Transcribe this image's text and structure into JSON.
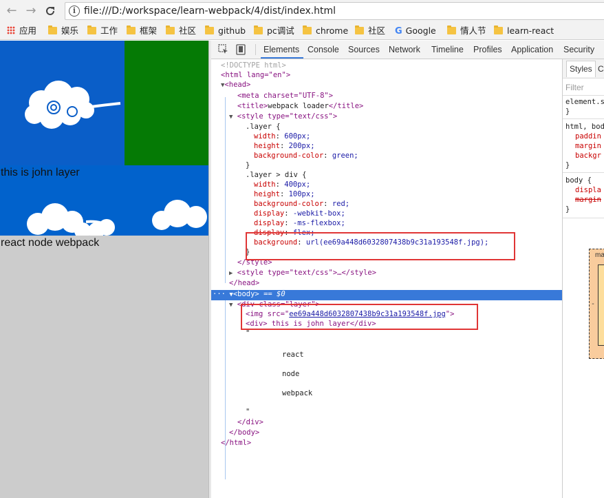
{
  "browser": {
    "url": "file:///D:/workspace/learn-webpack/4/dist/index.html",
    "info_icon_glyph": "i",
    "back_glyph": "←",
    "forward_glyph": "→",
    "reload_glyph": "C"
  },
  "bookmarks": [
    {
      "label": "应用",
      "icon": "apps-icon"
    },
    {
      "label": "娱乐",
      "icon": "folder-icon"
    },
    {
      "label": "工作",
      "icon": "folder-icon"
    },
    {
      "label": "框架",
      "icon": "folder-icon"
    },
    {
      "label": "社区",
      "icon": "folder-icon"
    },
    {
      "label": "github",
      "icon": "folder-icon"
    },
    {
      "label": "pc调试",
      "icon": "folder-icon"
    },
    {
      "label": "chrome",
      "icon": "folder-icon"
    },
    {
      "label": "社区",
      "icon": "folder-icon"
    },
    {
      "label": "Google",
      "icon": "google-icon",
      "glyph": "G"
    },
    {
      "label": "情人节",
      "icon": "folder-icon"
    },
    {
      "label": "learn-react",
      "icon": "folder-icon"
    }
  ],
  "page": {
    "layer_text": "this is john layer",
    "body_text": "react node webpack",
    "colors": {
      "layer_bg": "#0162cc",
      "green": "#057a05",
      "body_bg": "#cccccc"
    }
  },
  "devtools": {
    "tabs": [
      "Elements",
      "Console",
      "Sources",
      "Network",
      "Timeline",
      "Profiles",
      "Application",
      "Security"
    ],
    "active_tab": "Elements",
    "selected_marker": "== $0",
    "ellipsis": "···",
    "lines": {
      "doctype": "<!DOCTYPE html>",
      "html_open": "<html lang=\"en\">",
      "head_open": "<head>",
      "meta": "<meta charset=\"UTF-8\">",
      "title_open": "<title>",
      "title_text": "webpack loader",
      "title_close": "</title>",
      "style_open": "<style type=\"text/css\">",
      "css_layer_sel": ".layer {",
      "css_width1_prop": "width",
      "css_width1_val": "600px;",
      "css_height1_prop": "height",
      "css_height1_val": "200px;",
      "css_bg1_prop": "background-color",
      "css_bg1_val": "green;",
      "close_brace": "}",
      "css_div_sel": ".layer > div {",
      "css_width2_prop": "width",
      "css_width2_val": "400px;",
      "css_height2_prop": "height",
      "css_height2_val": "100px;",
      "css_bg2_prop": "background-color",
      "css_bg2_val": "red;",
      "css_disp1_prop": "display",
      "css_disp1_val": "-webkit-box;",
      "css_disp2_prop": "display",
      "css_disp2_val": "-ms-flexbox;",
      "css_disp3_prop": "display",
      "css_disp3_val": "flex;",
      "css_bgurl_prop": "background",
      "css_bgurl_val": "url(ee69a448d6032807438b9c31a193548f.jpg);",
      "style_close": "</style>",
      "style2": "<style type=\"text/css\">…</style>",
      "head_close": "</head>",
      "body_open": "<body>",
      "div_open": "<div class=\"layer\">",
      "img_open": "<img src=\"",
      "img_src": "ee69a448d6032807438b9c31a193548f.jpg",
      "img_close": "\">",
      "div_inner": "<div> this is john layer</div>",
      "quote": "\"",
      "text_react": "react",
      "text_node": "node",
      "text_webpack": "webpack",
      "div_close": "</div>",
      "body_close": "</body>",
      "html_close": "</html>"
    }
  },
  "styles_pane": {
    "tab": "Styles",
    "tab2": "Co",
    "filter_placeholder": "Filter",
    "lines": [
      "element.s",
      "}",
      "html, bod",
      "paddin",
      "margin",
      "backgr",
      "}",
      "body {",
      "displa",
      "margin",
      "}"
    ],
    "box_label": "ma",
    "box_dash": "-"
  }
}
